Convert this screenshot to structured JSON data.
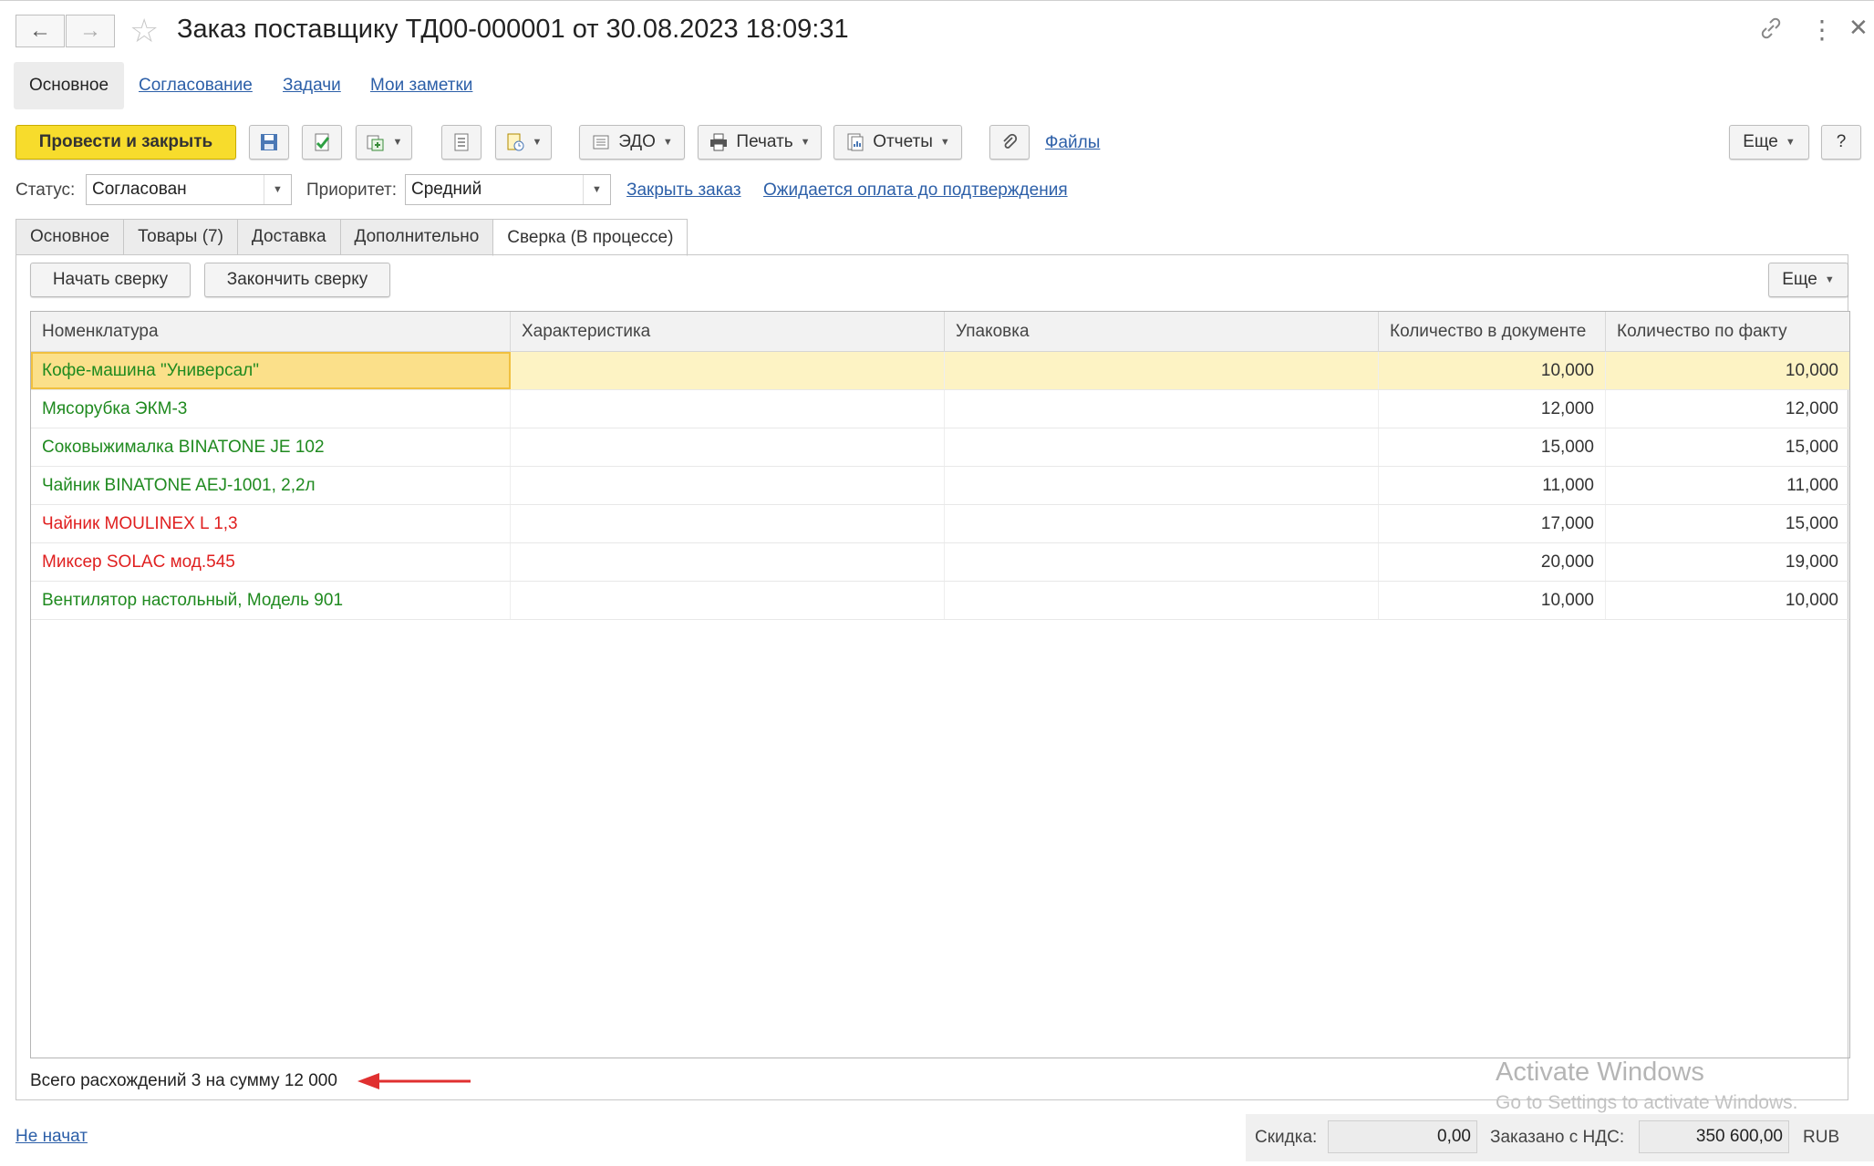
{
  "window": {
    "title": "Заказ поставщику ТД00-000001 от 30.08.2023 18:09:31"
  },
  "nav_tabs": [
    {
      "label": "Основное",
      "active": true
    },
    {
      "label": "Согласование"
    },
    {
      "label": "Задачи"
    },
    {
      "label": "Мои заметки"
    }
  ],
  "toolbar": {
    "post_close_label": "Провести и закрыть",
    "edo_label": "ЭДО",
    "print_label": "Печать",
    "reports_label": "Отчеты",
    "files_label": "Файлы",
    "more_label": "Еще",
    "help_label": "?"
  },
  "status_row": {
    "status_label": "Статус:",
    "status_value": "Согласован",
    "priority_label": "Приоритет:",
    "priority_value": "Средний",
    "close_order_link": "Закрыть заказ",
    "payment_link": "Ожидается оплата до подтверждения"
  },
  "doc_tabs": [
    {
      "label": "Основное"
    },
    {
      "label": "Товары (7)"
    },
    {
      "label": "Доставка"
    },
    {
      "label": "Дополнительно"
    },
    {
      "label": "Сверка (В процессе)",
      "active": true
    }
  ],
  "reconcile": {
    "start_label": "Начать сверку",
    "finish_label": "Закончить сверку",
    "more_label": "Еще"
  },
  "table": {
    "columns": [
      "Номенклатура",
      "Характеристика",
      "Упаковка",
      "Количество в документе",
      "Количество по факту"
    ],
    "rows": [
      {
        "item": "Кофе-машина \"Универсал\"",
        "characteristic": "",
        "package": "",
        "qty_doc": "10,000",
        "qty_fact": "10,000",
        "color": "#1f8a1f",
        "selected": true
      },
      {
        "item": "Мясорубка ЭКМ-3",
        "characteristic": "",
        "package": "",
        "qty_doc": "12,000",
        "qty_fact": "12,000",
        "color": "#1f8a1f"
      },
      {
        "item": "Соковыжималка  BINATONE JE 102",
        "characteristic": "",
        "package": "",
        "qty_doc": "15,000",
        "qty_fact": "15,000",
        "color": "#1f8a1f"
      },
      {
        "item": "Чайник BINATONE  AEJ-1001,  2,2л",
        "characteristic": "",
        "package": "",
        "qty_doc": "11,000",
        "qty_fact": "11,000",
        "color": "#1f8a1f"
      },
      {
        "item": "Чайник MOULINEX L 1,3",
        "characteristic": "",
        "package": "",
        "qty_doc": "17,000",
        "qty_fact": "15,000",
        "color": "#e02020"
      },
      {
        "item": "Миксер SOLAC мод.545",
        "characteristic": "",
        "package": "",
        "qty_doc": "20,000",
        "qty_fact": "19,000",
        "color": "#e02020"
      },
      {
        "item": "Вентилятор настольный, Модель 901",
        "characteristic": "",
        "package": "",
        "qty_doc": "10,000",
        "qty_fact": "10,000",
        "color": "#1f8a1f"
      }
    ]
  },
  "summary_text": "Всего расхождений 3 на сумму 12 000",
  "footer": {
    "state_link": "Не начат",
    "discount_label": "Скидка:",
    "discount_value": "0,00",
    "ordered_label": "Заказано с НДС:",
    "ordered_value": "350 600,00",
    "currency": "RUB"
  },
  "watermark": {
    "line1": "Activate Windows",
    "line2": "Go to Settings to activate Windows."
  },
  "colors": {
    "primary_button": "#f7dc2c",
    "link": "#2c5fa8",
    "ok_row_text": "#1f8a1f",
    "diff_row_text": "#e02020",
    "selected_row": "#fdf3c4",
    "arrow": "#e03030"
  }
}
